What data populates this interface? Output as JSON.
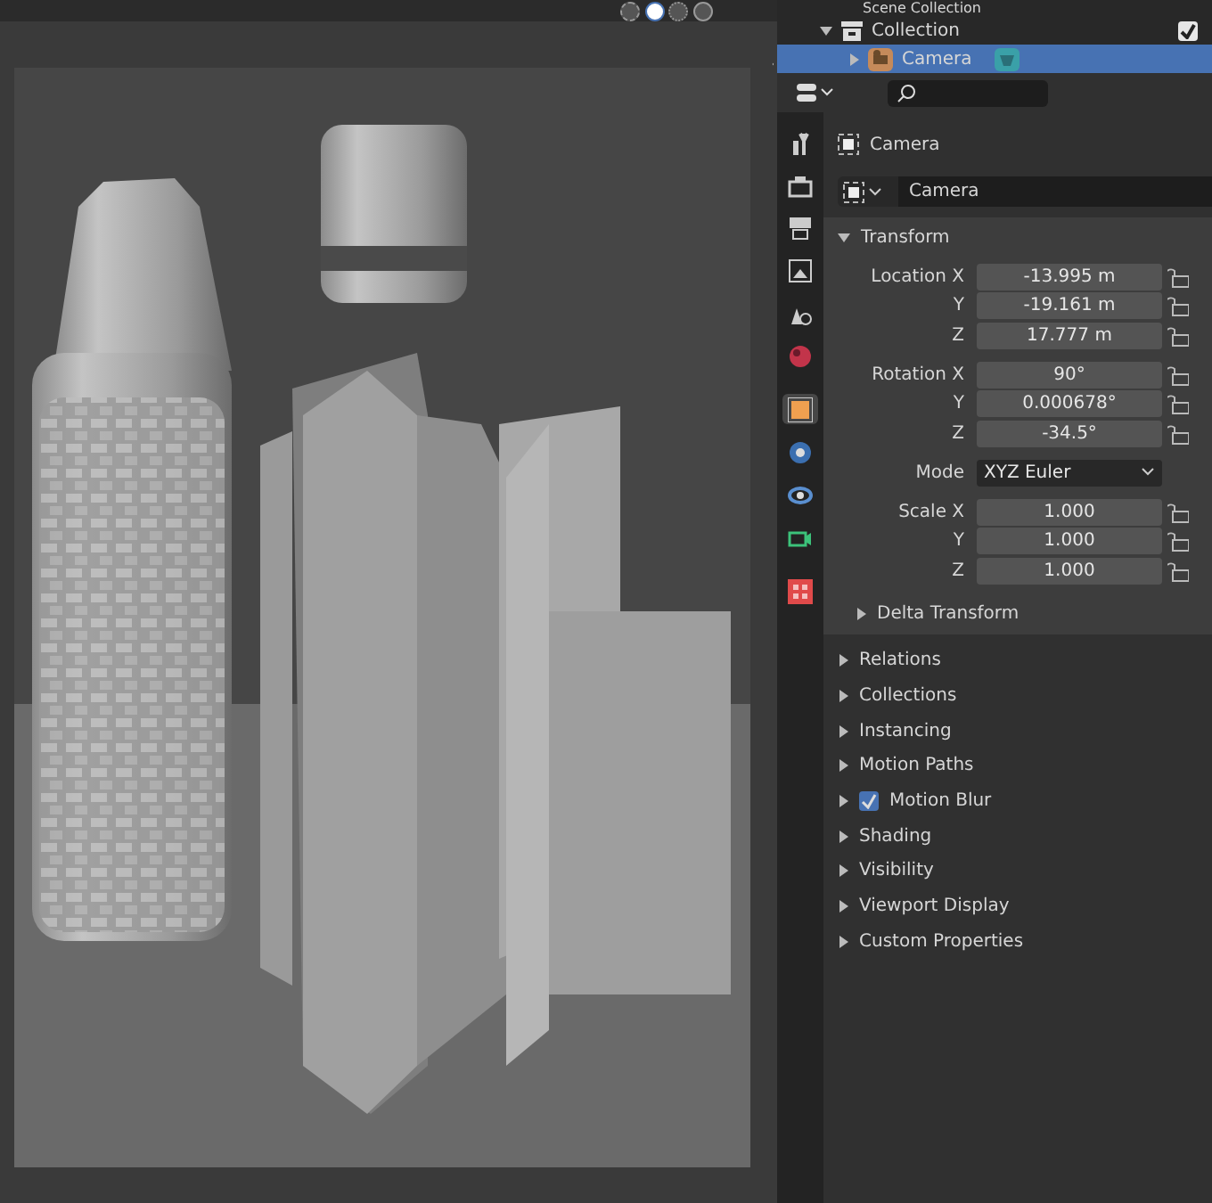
{
  "outliner": {
    "scene_collection": "Scene Collection",
    "collection": {
      "label": "Collection",
      "checked": true
    },
    "object": {
      "label": "Camera",
      "selected": true
    }
  },
  "viewport": {
    "shading_modes": [
      {
        "kind": "wire",
        "selected": false
      },
      {
        "kind": "solid",
        "selected": true
      },
      {
        "kind": "material",
        "selected": false
      },
      {
        "kind": "rendered",
        "selected": false
      }
    ]
  },
  "properties": {
    "tabs": [
      {
        "kind": "tool",
        "selected": false
      },
      {
        "kind": "render",
        "selected": false
      },
      {
        "kind": "output",
        "selected": false
      },
      {
        "kind": "view_layer",
        "selected": false
      },
      {
        "kind": "scene",
        "selected": false
      },
      {
        "kind": "world",
        "selected": false
      },
      {
        "kind": "object",
        "selected": true
      },
      {
        "kind": "physics",
        "selected": false
      },
      {
        "kind": "constraint",
        "selected": false
      },
      {
        "kind": "data",
        "selected": false
      },
      {
        "kind": "texture",
        "selected": false
      }
    ],
    "object_name": "Camera",
    "data_name": "Camera",
    "transform": {
      "title": "Transform",
      "expanded": true,
      "groups": [
        {
          "rows": [
            {
              "label": "Location X",
              "value": "-13.995 m",
              "locked": false
            },
            {
              "label": "Y",
              "value": "-19.161 m",
              "locked": false
            },
            {
              "label": "Z",
              "value": "17.777 m",
              "locked": false
            }
          ]
        },
        {
          "rows": [
            {
              "label": "Rotation X",
              "value": "90°",
              "locked": false
            },
            {
              "label": "Y",
              "value": "0.000678°",
              "locked": false
            },
            {
              "label": "Z",
              "value": "-34.5°",
              "locked": false
            }
          ]
        },
        {
          "mode": {
            "label": "Mode",
            "value": "XYZ Euler"
          }
        },
        {
          "rows": [
            {
              "label": "Scale X",
              "value": "1.000",
              "locked": false
            },
            {
              "label": "Y",
              "value": "1.000",
              "locked": false
            },
            {
              "label": "Z",
              "value": "1.000",
              "locked": false
            }
          ]
        }
      ],
      "subpanel": {
        "title": "Delta Transform",
        "expanded": false
      }
    },
    "panels": [
      {
        "title": "Relations",
        "kind": "plain",
        "expanded": false
      },
      {
        "title": "Collections",
        "kind": "plain",
        "expanded": false
      },
      {
        "title": "Instancing",
        "kind": "plain",
        "expanded": false
      },
      {
        "title": "Motion Paths",
        "kind": "plain",
        "expanded": false
      },
      {
        "title": "Motion Blur",
        "kind": "checkbox",
        "checked": true,
        "expanded": false
      },
      {
        "title": "Shading",
        "kind": "plain",
        "expanded": false
      },
      {
        "title": "Visibility",
        "kind": "plain",
        "expanded": false
      },
      {
        "title": "Viewport Display",
        "kind": "plain",
        "expanded": false
      },
      {
        "title": "Custom Properties",
        "kind": "plain",
        "expanded": false
      }
    ]
  }
}
